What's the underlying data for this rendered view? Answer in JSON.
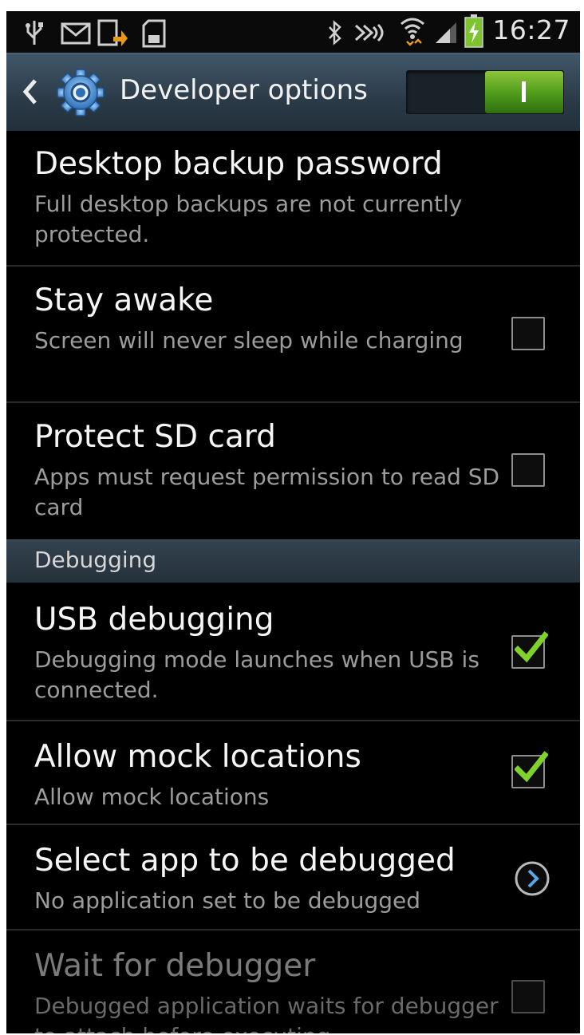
{
  "status_bar": {
    "time": "16:27",
    "icons": [
      "usb-icon",
      "mail-icon",
      "download-icon",
      "sdcard-icon",
      "bluetooth-icon",
      "nfc-icon",
      "wifi-icon",
      "signal-icon",
      "battery-charging-icon"
    ]
  },
  "action_bar": {
    "title": "Developer options",
    "master_switch_on": true,
    "accent": "#4e9a1a"
  },
  "settings": {
    "desktop_backup": {
      "title": "Desktop backup password",
      "summary": "Full desktop backups are not currently protected."
    },
    "stay_awake": {
      "title": "Stay awake",
      "summary": "Screen will never sleep while charging",
      "checked": false
    },
    "protect_sd": {
      "title": "Protect SD card",
      "summary": "Apps must request permission to read SD card",
      "checked": false
    },
    "debugging_header": "Debugging",
    "usb_debugging": {
      "title": "USB debugging",
      "summary": "Debugging mode launches when USB is connected.",
      "checked": true
    },
    "mock_locations": {
      "title": "Allow mock locations",
      "summary": "Allow mock locations",
      "checked": true
    },
    "debug_app": {
      "title": "Select app to be debugged",
      "summary": "No application set to be debugged"
    },
    "wait_debugger": {
      "title": "Wait for debugger",
      "summary": "Debugged application waits for debugger to attach before executing",
      "checked": false,
      "enabled": false
    }
  }
}
